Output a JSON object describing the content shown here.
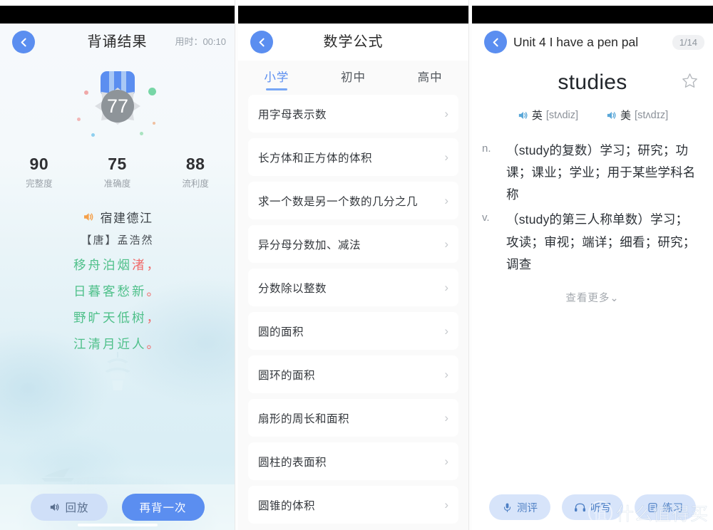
{
  "panel1": {
    "name": "recitation-result",
    "nav": {
      "back_icon": "chevron-left-icon",
      "title": "背诵结果",
      "timer": "用时：00:10"
    },
    "medal": {
      "score": "77",
      "icon": "medal-badge-icon"
    },
    "scores": [
      {
        "value": "90",
        "label": "完整度"
      },
      {
        "value": "75",
        "label": "准确度"
      },
      {
        "value": "88",
        "label": "流利度"
      }
    ],
    "poem": {
      "speaker_icon": "speaker-icon",
      "title": "宿建德江",
      "author": "【唐】孟浩然",
      "lines": [
        {
          "ok": "移舟泊烟",
          "err": "渚",
          "punc": "，"
        },
        {
          "ok": "日暮客愁新",
          "err": "",
          "punc": "。"
        },
        {
          "ok": "野旷天低树",
          "err": "",
          "punc": "，"
        },
        {
          "ok": "江清月近人",
          "err": "",
          "punc": "。"
        }
      ]
    },
    "footer": {
      "replay_icon": "speaker-icon",
      "replay_label": "回放",
      "again_label": "再背一次"
    }
  },
  "panel2": {
    "name": "math-formulas",
    "nav": {
      "back_icon": "chevron-left-icon",
      "title": "数学公式"
    },
    "tabs": [
      {
        "label": "小学",
        "active": true
      },
      {
        "label": "初中",
        "active": false
      },
      {
        "label": "高中",
        "active": false
      }
    ],
    "items": [
      {
        "label": "用字母表示数"
      },
      {
        "label": "长方体和正方体的体积"
      },
      {
        "label": "求一个数是另一个数的几分之几"
      },
      {
        "label": "异分母分数加、减法"
      },
      {
        "label": "分数除以整数"
      },
      {
        "label": "圆的面积"
      },
      {
        "label": "圆环的面积"
      },
      {
        "label": "扇形的周长和面积"
      },
      {
        "label": "圆柱的表面积"
      },
      {
        "label": "圆锥的体积"
      }
    ],
    "chevron": "›"
  },
  "panel3": {
    "name": "word-detail",
    "nav": {
      "back_icon": "chevron-left-icon",
      "title": "Unit 4 I have a pen pal",
      "counter": "1/14"
    },
    "word": "studies",
    "star_icon": "star-outline-icon",
    "phonetics": [
      {
        "speaker_icon": "speaker-icon",
        "lang": "英",
        "ipa": "[stʌdiz]"
      },
      {
        "speaker_icon": "speaker-icon",
        "lang": "美",
        "ipa": "[stʌdɪz]"
      }
    ],
    "definitions": [
      {
        "pos": "n.",
        "text": "（study的复数）学习；研究；功课；课业；学业；用于某些学科名称"
      },
      {
        "pos": "v.",
        "text": "（study的第三人称单数）学习；攻读；审视；端详；细看；研究；调查"
      }
    ],
    "see_more": "查看更多",
    "see_more_icon": "chevron-down-icon",
    "footer": [
      {
        "icon": "microphone-icon",
        "label": "测评"
      },
      {
        "icon": "headphones-icon",
        "label": "听写"
      },
      {
        "icon": "notebook-icon",
        "label": "练习"
      }
    ]
  },
  "watermark": {
    "mark": "值",
    "text": "什么值得买"
  },
  "colors": {
    "accent_blue": "#5b8ef0",
    "poem_green": "#4fc08a",
    "poem_error": "#f06a6a",
    "speaker_orange": "#f5a04a",
    "badge_gray": "#8e9499"
  }
}
